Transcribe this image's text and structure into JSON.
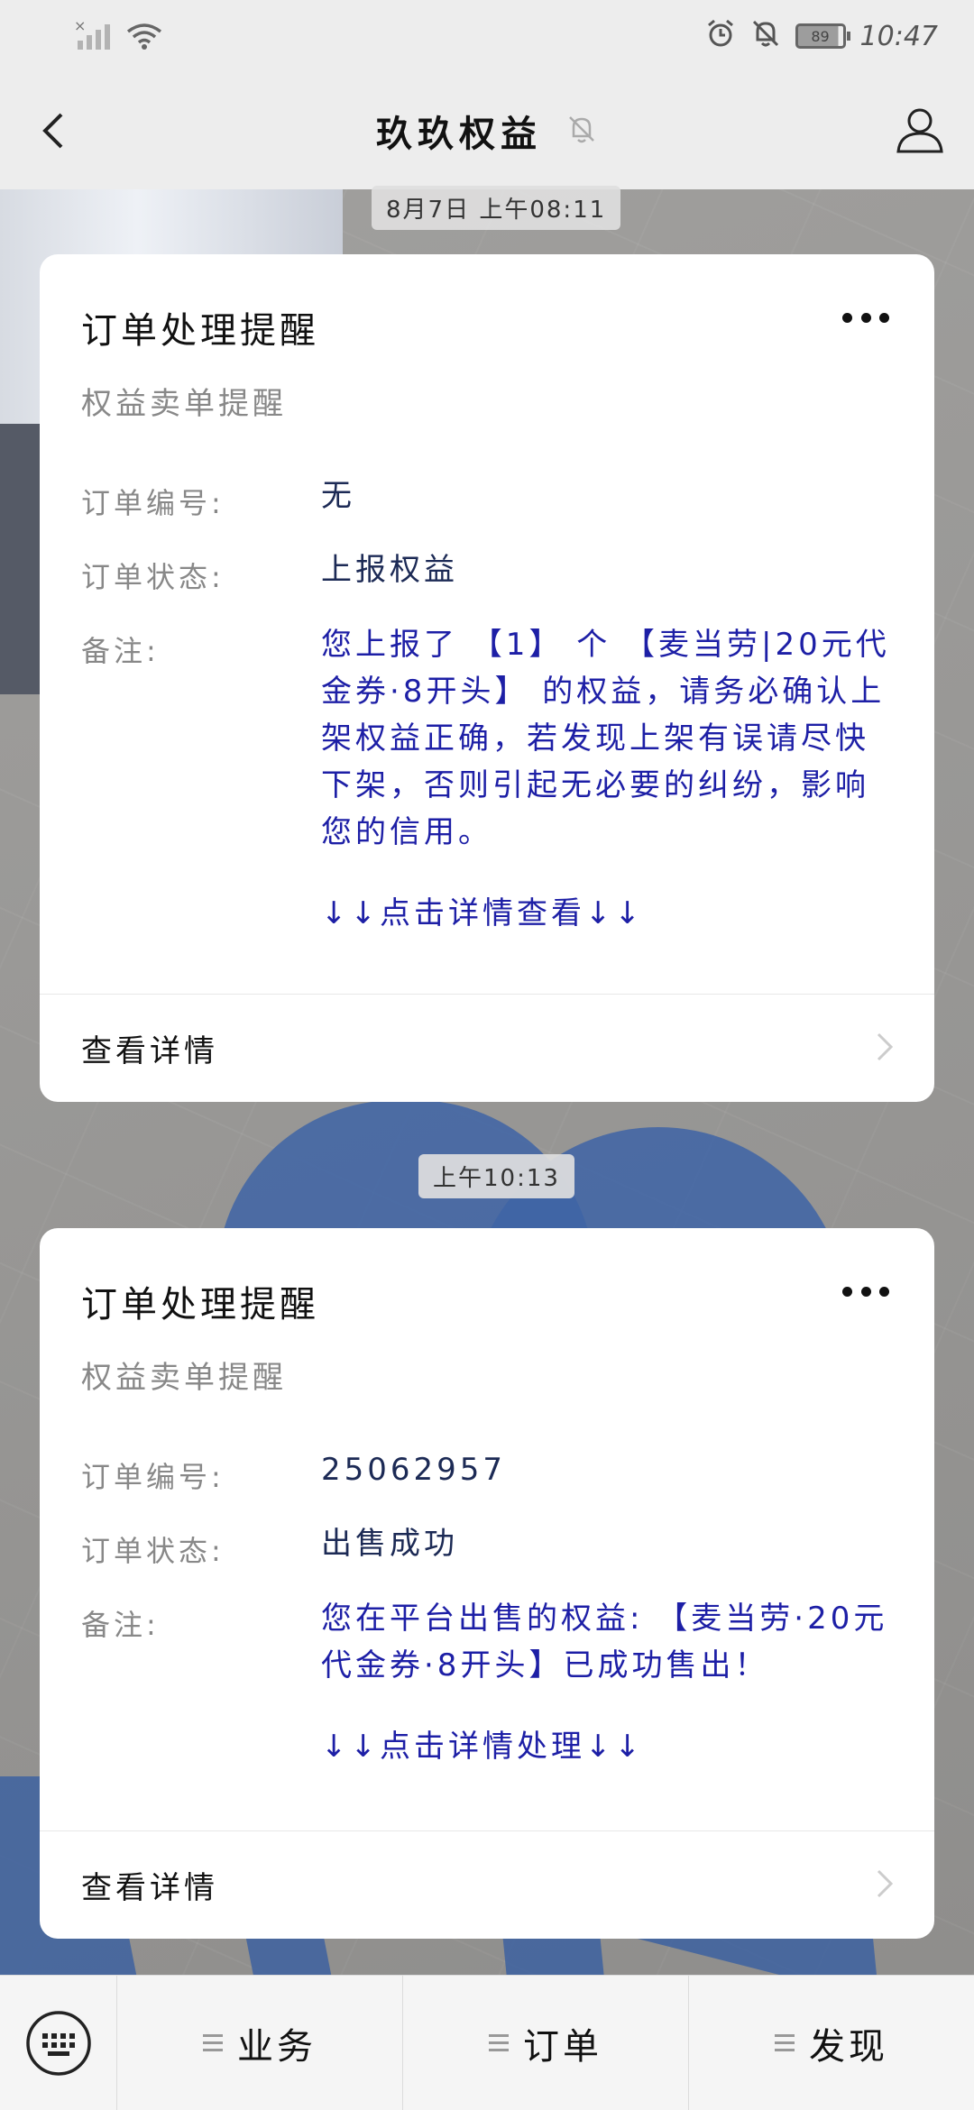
{
  "status_bar": {
    "battery": "89",
    "time": "10:47"
  },
  "nav": {
    "title": "玖玖权益"
  },
  "messages": [
    {
      "timestamp": "8月7日 上午08:11",
      "card": {
        "title": "订单处理提醒",
        "subtitle": "权益卖单提醒",
        "fields": [
          {
            "label": "订单编号:",
            "value": "无"
          },
          {
            "label": "订单状态:",
            "value": "上报权益"
          },
          {
            "label": "备注:",
            "value": "您上报了 【1】 个 【麦当劳|20元代金券·8开头】 的权益，请务必确认上架权益正确，若发现上架有误请尽快下架，否则引起无必要的纠纷，影响您的信用。"
          }
        ],
        "hint": "↓↓点击详情查看↓↓",
        "footer": "查看详情"
      }
    },
    {
      "timestamp": "上午10:13",
      "card": {
        "title": "订单处理提醒",
        "subtitle": "权益卖单提醒",
        "fields": [
          {
            "label": "订单编号:",
            "value": "25062957"
          },
          {
            "label": "订单状态:",
            "value": "出售成功"
          },
          {
            "label": "备注:",
            "value": "您在平台出售的权益: 【麦当劳·20元代金券·8开头】已成功售出！"
          }
        ],
        "hint": "↓↓点击详情处理↓↓",
        "footer": "查看详情"
      }
    }
  ],
  "bottom_menu": {
    "items": [
      {
        "label": "业务"
      },
      {
        "label": "订单"
      },
      {
        "label": "发现"
      }
    ]
  },
  "colors": {
    "accent_blue": "#1d1fa6",
    "value_dark": "#1c2a55",
    "muted": "#888888"
  }
}
